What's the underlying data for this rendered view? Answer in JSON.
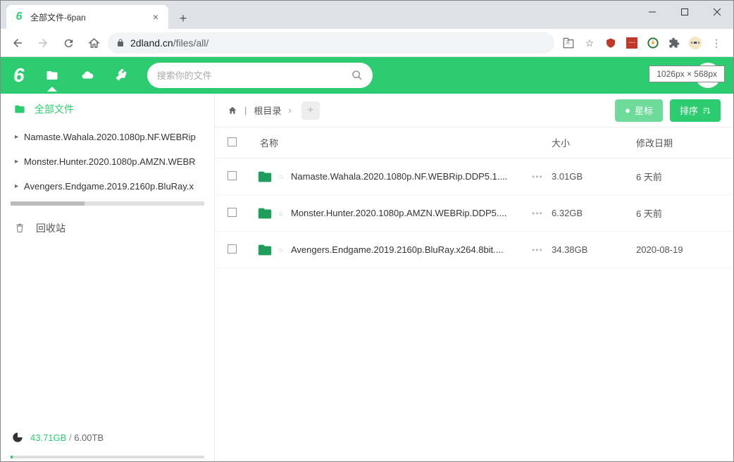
{
  "browser": {
    "tab_title": "全部文件-6pan",
    "url_host": "2dland.cn",
    "url_path": "/files/all/"
  },
  "overlay": {
    "dimensions": "1026px × 568px"
  },
  "header": {
    "search_placeholder": "搜索你的文件"
  },
  "sidebar": {
    "root_label": "全部文件",
    "items": [
      {
        "label": "Namaste.Wahala.2020.1080p.NF.WEBRip"
      },
      {
        "label": "Monster.Hunter.2020.1080p.AMZN.WEBR"
      },
      {
        "label": "Avengers.Endgame.2019.2160p.BluRay.x"
      }
    ],
    "trash_label": "回收站",
    "storage_used": "43.71GB",
    "storage_total": "6.00TB"
  },
  "breadcrumb": {
    "root": "根目录",
    "star_label": "星标",
    "sort_label": "排序"
  },
  "table": {
    "col_name": "名称",
    "col_size": "大小",
    "col_date": "修改日期"
  },
  "files": [
    {
      "name": "Namaste.Wahala.2020.1080p.NF.WEBRip.DDP5.1....",
      "size": "3.01GB",
      "date": "6 天前"
    },
    {
      "name": "Monster.Hunter.2020.1080p.AMZN.WEBRip.DDP5....",
      "size": "6.32GB",
      "date": "6 天前"
    },
    {
      "name": "Avengers.Endgame.2019.2160p.BluRay.x264.8bit....",
      "size": "34.38GB",
      "date": "2020-08-19"
    }
  ]
}
